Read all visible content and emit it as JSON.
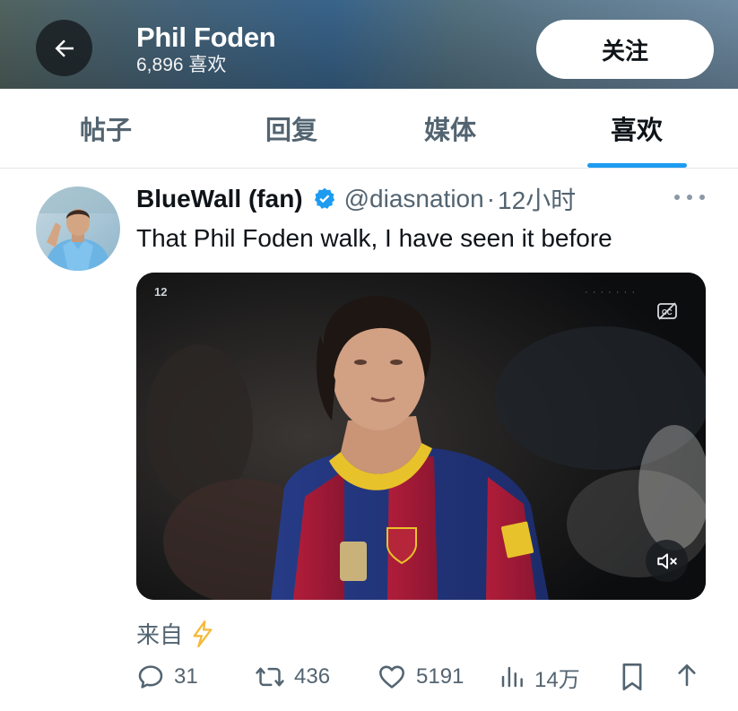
{
  "header": {
    "name": "Phil Foden",
    "likes_count": "6,896 喜欢",
    "follow_label": "关注",
    "icons": {
      "back": "arrow-left-icon"
    }
  },
  "tabs": [
    {
      "label": "帖子",
      "active": false
    },
    {
      "label": "回复",
      "active": false
    },
    {
      "label": "媒体",
      "active": false
    },
    {
      "label": "喜欢",
      "active": true
    }
  ],
  "tweet": {
    "author_name": "BlueWall (fan)",
    "verified": true,
    "handle": "@diasnation",
    "separator": "·",
    "time": "12小时",
    "text": "That Phil Foden walk, I have seen it before",
    "media": {
      "age_badge": "12",
      "cc_icon": "closed-captions-off-icon",
      "mute_icon": "speaker-muted-icon"
    },
    "source_label": "来自",
    "source_icon": "lightning-bolt-icon",
    "actions": {
      "replies": "31",
      "reposts": "436",
      "likes": "5191",
      "views": "14万"
    }
  },
  "colors": {
    "accent": "#1d9bf0",
    "text_primary": "#0f1419",
    "text_secondary": "#536471",
    "bolt": "#f5b93a"
  }
}
